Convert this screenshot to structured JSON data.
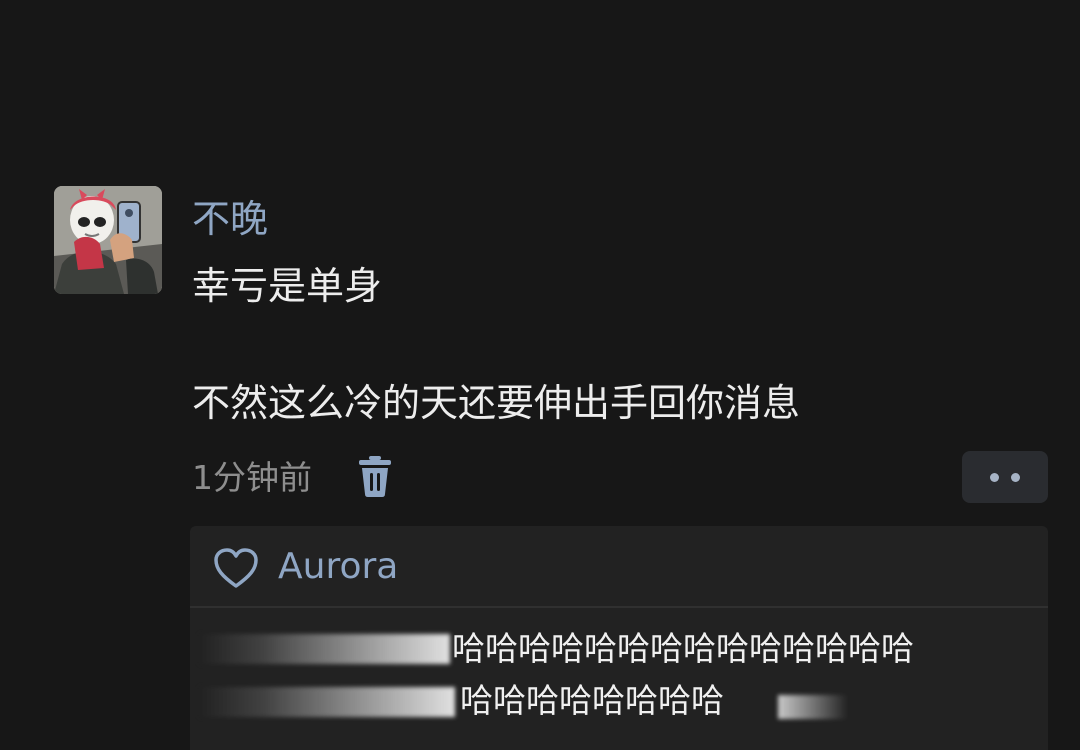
{
  "comment": {
    "username": "不晚",
    "text_line_1": "幸亏是单身",
    "text_line_2": "不然这么冷的天还要伸出手回你消息",
    "timestamp": "1分钟前"
  },
  "icons": {
    "delete": "trash-icon",
    "more": "more-dots-icon",
    "like": "heart-icon"
  },
  "reply_panel": {
    "liked_by": "Aurora",
    "reply_line_1": "哈哈哈哈哈哈哈哈哈哈哈哈哈哈",
    "reply_line_2": "哈哈哈哈哈哈哈哈"
  },
  "colors": {
    "background": "#171717",
    "username_accent": "#8fa6c4",
    "reply_panel_bg": "#222222"
  }
}
